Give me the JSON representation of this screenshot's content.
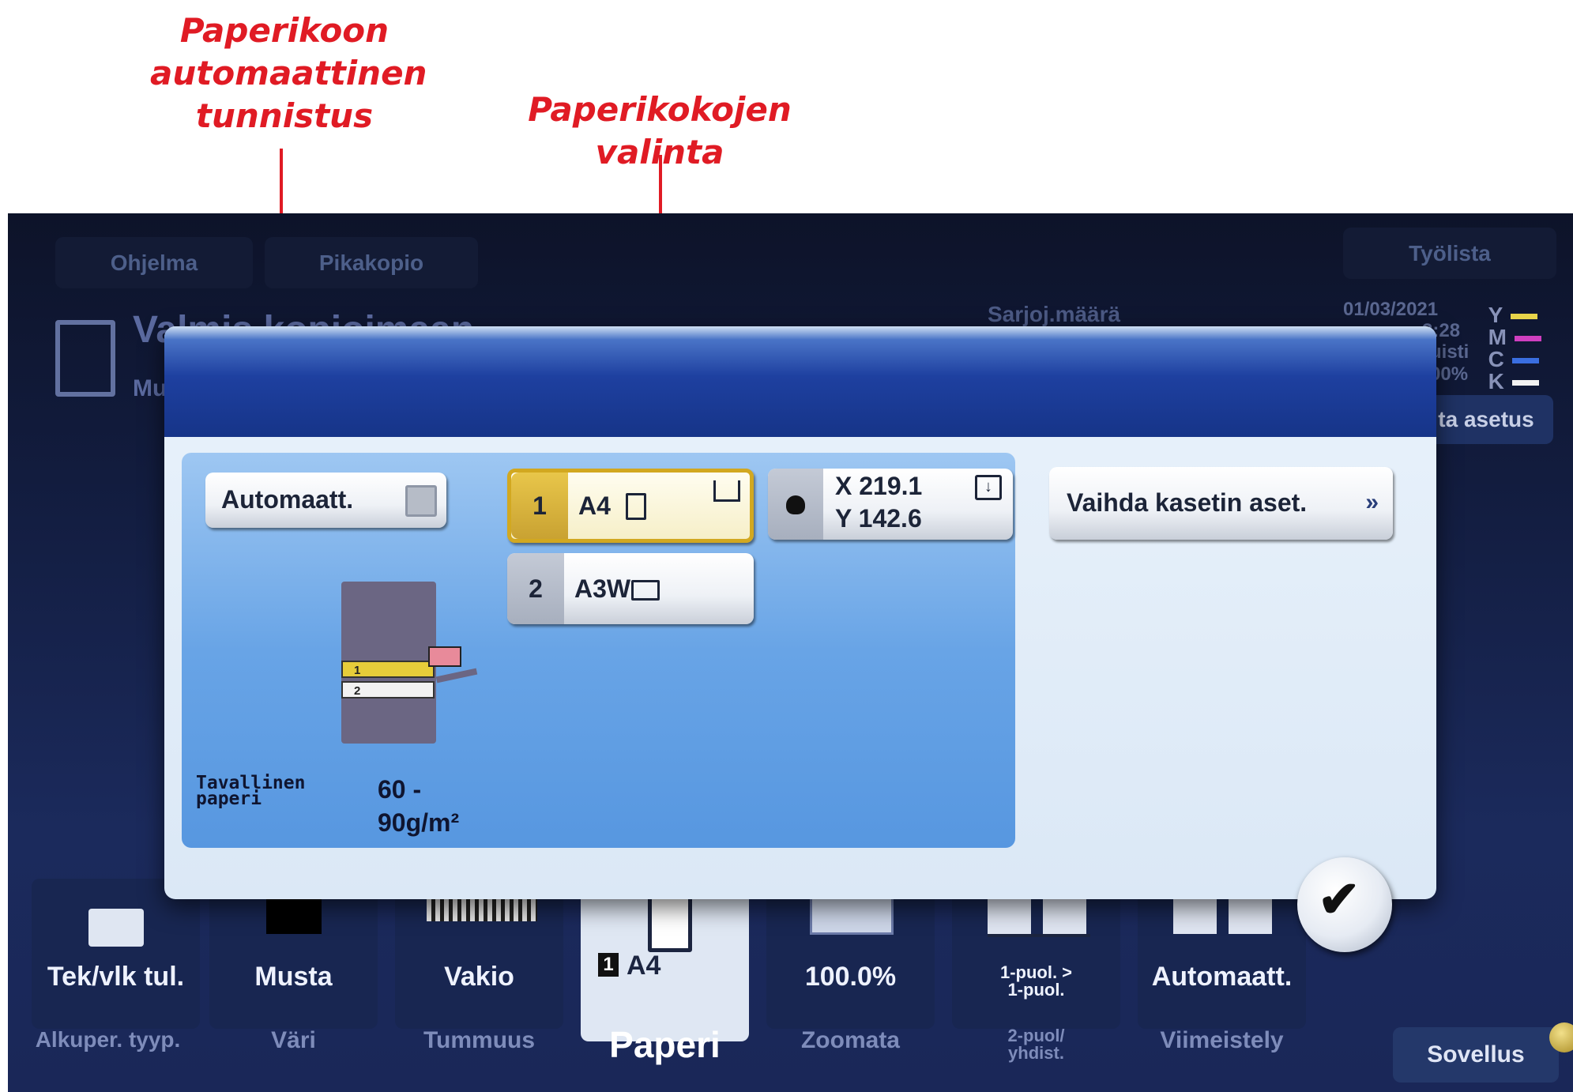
{
  "annotations": {
    "auto_detect": "Paperikoon\nautomaattinen\ntunnistus",
    "size_select": "Paperikokojen valinta"
  },
  "screen": {
    "tabs": [
      "Ohjelma",
      "Pikakopio",
      "Työlista"
    ],
    "status_title": "Valmis kopioimaan",
    "status_sub": "Mu",
    "sets_label": "Sarjoj.määrä",
    "date": "01/03/2021",
    "time_partial": "3:28",
    "memory_partial": "uisti",
    "memory_pct": "00%",
    "toner": [
      {
        "label": "Y",
        "color": "#e8d44a"
      },
      {
        "label": "M",
        "color": "#cf3fbf"
      },
      {
        "label": "C",
        "color": "#3a6ee0"
      },
      {
        "label": "K",
        "color": "#f2f2f2"
      }
    ],
    "side_button": "ta asetus"
  },
  "dialog": {
    "auto_button": "Automaatt.",
    "tray1": {
      "num": "1",
      "size": "A4"
    },
    "tray2": {
      "num": "2",
      "size": "A3W"
    },
    "manual": {
      "x": "X 219.1",
      "y": "Y 142.6"
    },
    "change_tray": "Vaihda kasetin aset.",
    "paper_type": "Tavallinen\npaperi",
    "weight": "60 -\n90g/m²",
    "diagram_tray1": "1",
    "diagram_tray2": "2"
  },
  "functions": [
    {
      "value": "Tek/vlk tul.",
      "label": "Alkuper. tyyp."
    },
    {
      "value": "Musta",
      "label": "Väri"
    },
    {
      "value": "Vakio",
      "label": "Tummuus"
    },
    {
      "value": "A4",
      "tray": "1",
      "label": "Paperi"
    },
    {
      "value": "100.0%",
      "label": "Zoomata"
    },
    {
      "value": "1-puol. >\n1-puol.",
      "label": "2-puol/\nyhdist."
    },
    {
      "value": "Automaatt.",
      "label": "Viimeistely"
    }
  ],
  "sovellus": "Sovellus"
}
